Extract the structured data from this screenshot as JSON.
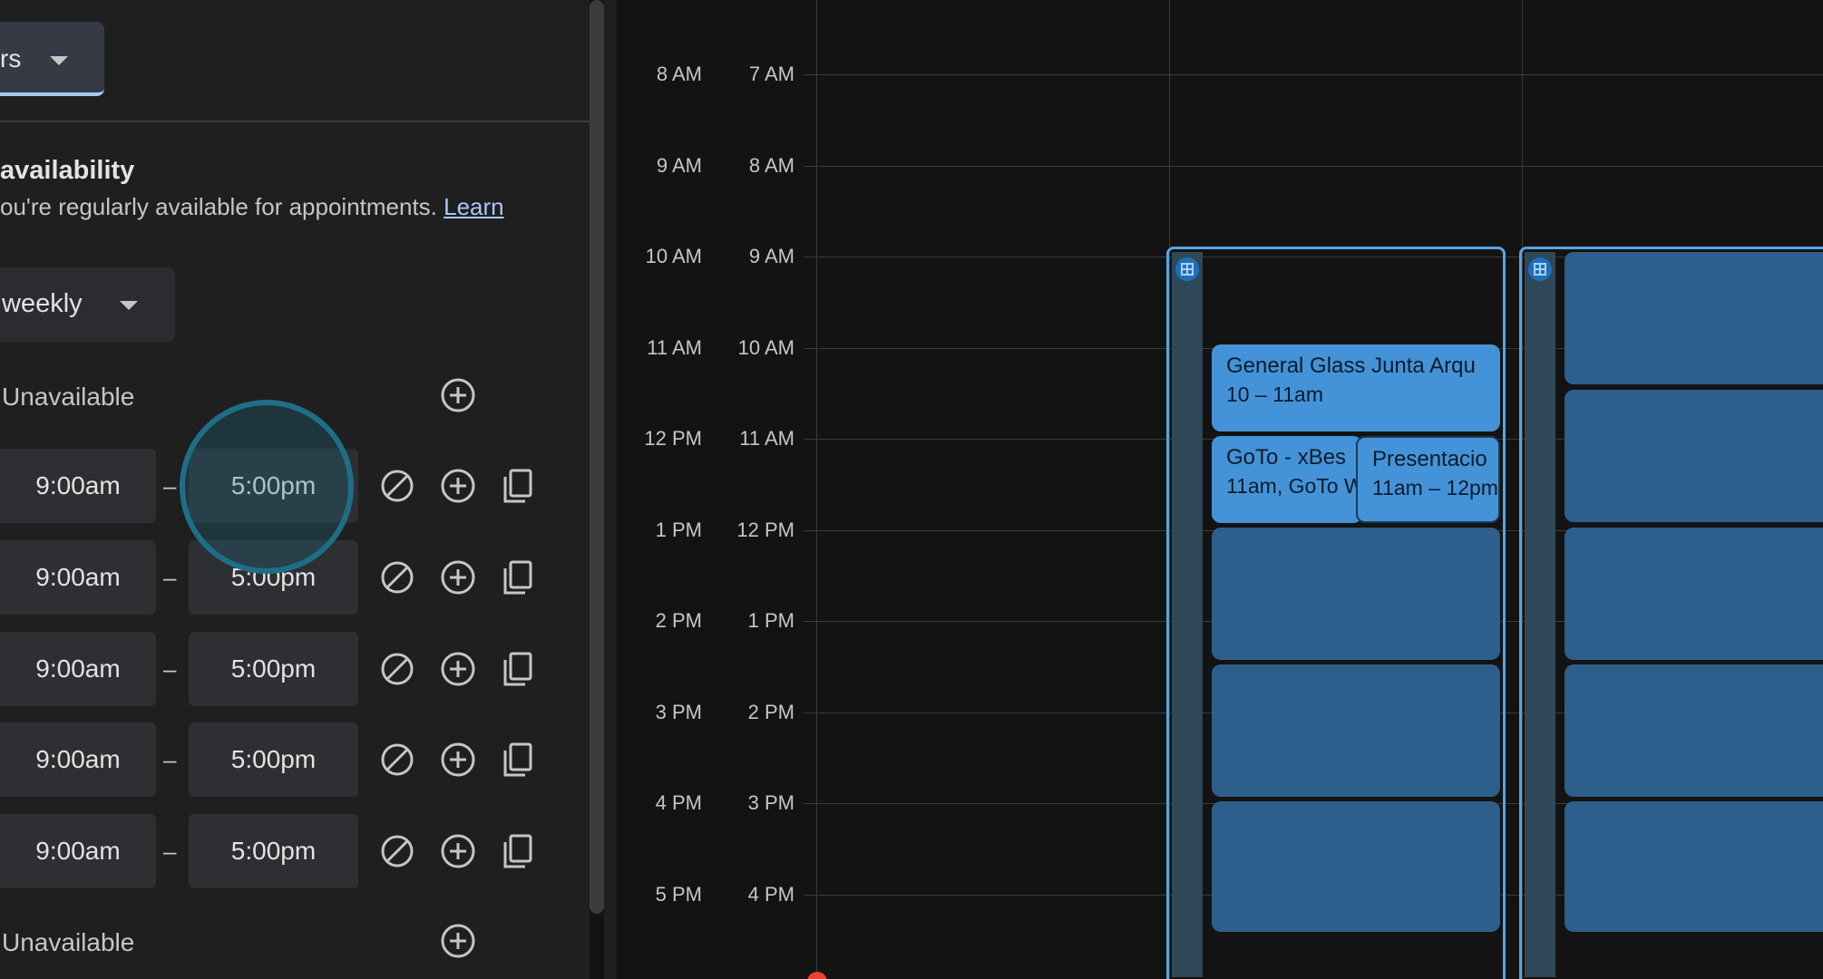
{
  "settings": {
    "duration_dropdown": {
      "value": "rs"
    },
    "availability": {
      "title": "availability",
      "description_prefix": "ou're regularly available for appointments.",
      "learn_link": "Learn",
      "repeat_dropdown": {
        "value": "weekly"
      },
      "first_unavailable": "Unavailable",
      "rows": [
        {
          "start": "9:00am",
          "separator": "–",
          "end": "5:00pm"
        },
        {
          "start": "9:00am",
          "separator": "–",
          "end": "5:00pm"
        },
        {
          "start": "9:00am",
          "separator": "–",
          "end": "5:00pm"
        },
        {
          "start": "9:00am",
          "separator": "–",
          "end": "5:00pm"
        },
        {
          "start": "9:00am",
          "separator": "–",
          "end": "5:00pm"
        }
      ],
      "last_unavailable": "Unavailable"
    }
  },
  "calendar": {
    "primary_times": [
      "8 AM",
      "9 AM",
      "10 AM",
      "11 AM",
      "12 PM",
      "1 PM",
      "2 PM",
      "3 PM",
      "4 PM",
      "5 PM"
    ],
    "secondary_times": [
      "7 AM",
      "8 AM",
      "9 AM",
      "10 AM",
      "11 AM",
      "12 PM",
      "1 PM",
      "2 PM",
      "3 PM",
      "4 PM"
    ],
    "events": [
      {
        "title": "General Glass Junta Arqu",
        "time": "10 – 11am"
      },
      {
        "title": "GoTo - xBes",
        "time": "11am, GoTo W"
      },
      {
        "title": "Presentacio",
        "time": "11am – 12pm"
      }
    ]
  },
  "colors": {
    "accent": "#a8c7fa",
    "event_blue": "#4493d8",
    "slot_blue": "#2e5f8c",
    "appointment_border": "#5aa3e0",
    "highlight_ring": "#1f6e88",
    "now_indicator": "#ea4335"
  },
  "icons": {
    "row_actions": [
      "block-icon",
      "add-circle-icon",
      "copy-icon"
    ],
    "appointment_schedule": "grid-icon"
  }
}
